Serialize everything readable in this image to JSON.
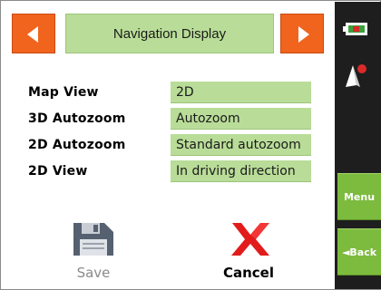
{
  "header": {
    "title": "Navigation Display",
    "prev_icon": "left-arrow-icon",
    "next_icon": "right-arrow-icon",
    "accent_color": "#f0641e"
  },
  "settings": [
    {
      "label": "Map View",
      "value": "2D"
    },
    {
      "label": "3D Autozoom",
      "value": "Autozoom"
    },
    {
      "label": "2D Autozoom",
      "value": "Standard autozoom"
    },
    {
      "label": "2D View",
      "value": "In driving direction"
    }
  ],
  "actions": {
    "save_label": "Save",
    "save_icon": "floppy-disk-icon",
    "save_enabled": false,
    "cancel_label": "Cancel",
    "cancel_icon": "red-x-icon"
  },
  "sidebar": {
    "battery_icon": "battery-icon",
    "compass_icon": "compass-icon",
    "menu_label": "Menu",
    "back_label": "◄Back",
    "button_color": "#7dbb3e"
  }
}
